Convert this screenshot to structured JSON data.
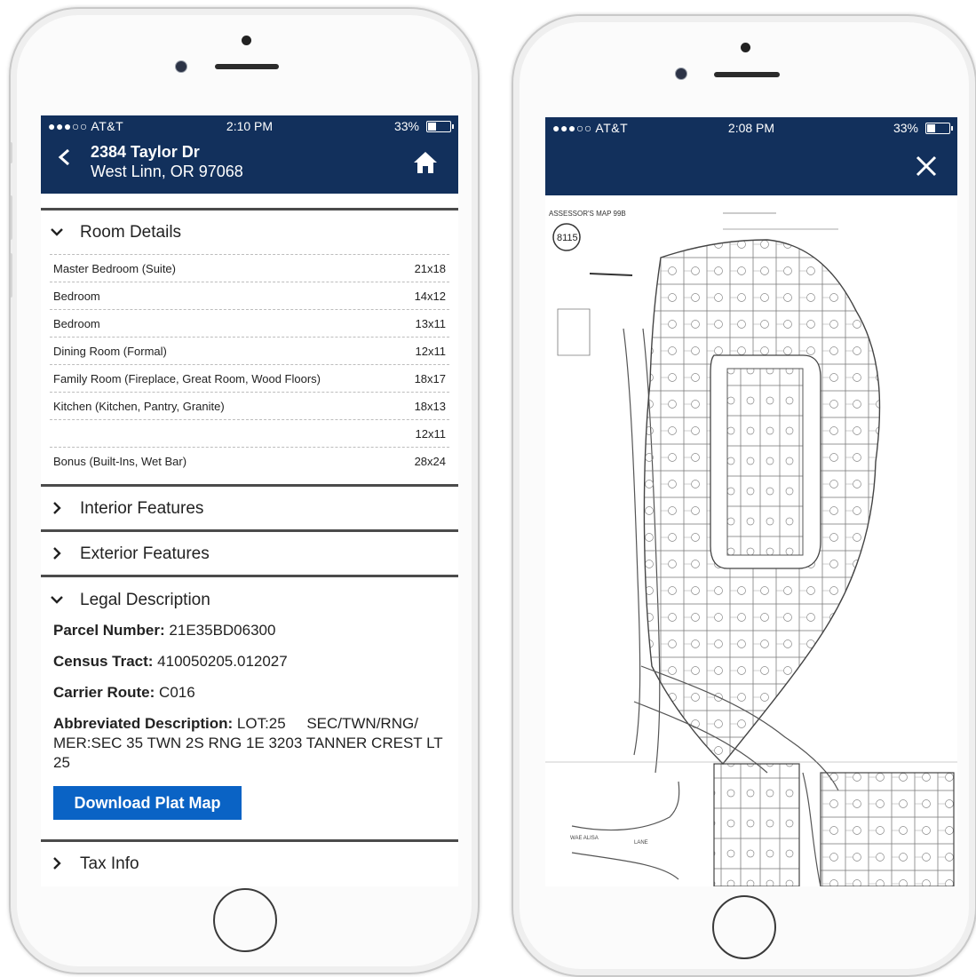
{
  "left_phone": {
    "status": {
      "carrier": "●●●○○ AT&T",
      "time": "2:10 PM",
      "battery": "33%",
      "battery_level": 0.33
    },
    "header": {
      "street": "2384 Taylor Dr",
      "city": "West Linn, OR 97068"
    },
    "room_details": {
      "title": "Room Details",
      "rooms": [
        {
          "name": "Master Bedroom (Suite)",
          "size": "21x18"
        },
        {
          "name": "Bedroom",
          "size": "14x12"
        },
        {
          "name": "Bedroom",
          "size": "13x11"
        },
        {
          "name": "Dining Room (Formal)",
          "size": "12x11"
        },
        {
          "name": "Family Room (Fireplace, Great Room, Wood Floors)",
          "size": "18x17"
        },
        {
          "name": "Kitchen (Kitchen, Pantry, Granite)",
          "size": "18x13"
        },
        {
          "name": "",
          "size": "12x11"
        },
        {
          "name": "Bonus (Built-Ins, Wet Bar)",
          "size": "28x24"
        }
      ]
    },
    "interior_features": "Interior Features",
    "exterior_features": "Exterior Features",
    "legal": {
      "title": "Legal Description",
      "parcel_label": "Parcel Number:",
      "parcel_value": "21E35BD06300",
      "census_label": "Census Tract:",
      "census_value": "410050205.012027",
      "carrier_label": "Carrier Route:",
      "carrier_value": "C016",
      "abbrev_label": "Abbreviated Description:",
      "abbrev_value": "LOT:25     SEC/TWN/RNG/ MER:SEC 35 TWN 2S RNG 1E 3203 TANNER CREST LT 25",
      "download_label": "Download Plat Map"
    },
    "tax_info": "Tax Info"
  },
  "right_phone": {
    "status": {
      "carrier": "●●●○○ AT&T",
      "time": "2:08 PM",
      "battery": "33%",
      "battery_level": 0.33
    },
    "map": {
      "title": "ASSESSOR'S MAP 99B",
      "map_number": "8115",
      "street_label_1": "WAE ALISA",
      "street_label_2": "LANE"
    }
  }
}
